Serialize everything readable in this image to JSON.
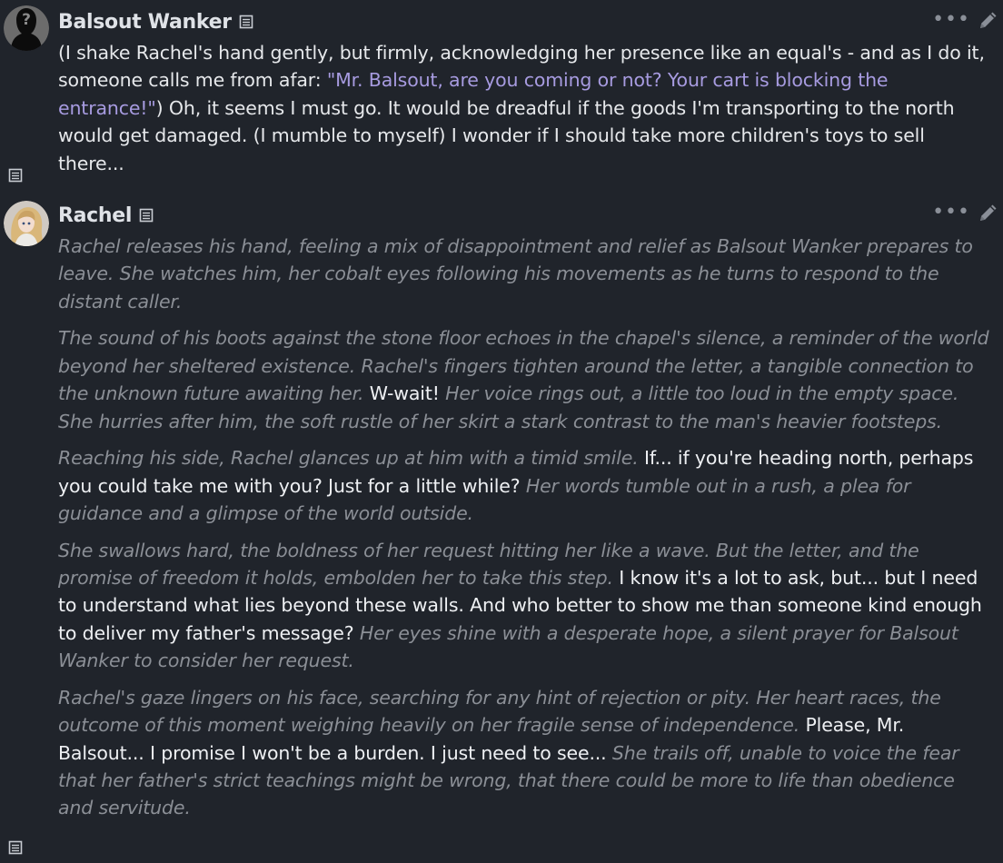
{
  "messages": [
    {
      "author": "Balsout Wanker",
      "avatar_icon": "question-mark-silhouette-avatar",
      "text_parts": [
        "(I shake Rachel's hand gently, but firmly, acknowledging her presence like an equal's - and as I do it, someone calls me from afar: ",
        "\"Mr. Balsout, are you coming or not? Your cart is blocking the entrance!\"",
        ") Oh, it seems I must go. It would be dreadful if the goods I'm transporting to the north would get damaged. (I mumble to myself) I wonder if I should take more children's toys to sell there..."
      ]
    },
    {
      "author": "Rachel",
      "avatar_icon": "blonde-girl-avatar",
      "paragraphs": [
        {
          "narration_1": "Rachel releases his hand, feeling a mix of disappointment and relief as Balsout Wanker prepares to leave. She watches him, her cobalt eyes following his movements as he turns to respond to the distant caller."
        },
        {
          "narration_1": "The sound of his boots against the stone floor echoes in the chapel's silence, a reminder of the world beyond her sheltered existence. Rachel's fingers tighten around the letter, a tangible connection to the unknown future awaiting her.",
          "speech": "W-wait!",
          "narration_2": "Her voice rings out, a little too loud in the empty space. She hurries after him, the soft rustle of her skirt a stark contrast to the man's heavier footsteps."
        },
        {
          "narration_1": "Reaching his side, Rachel glances up at him with a timid smile.",
          "speech": "If... if you're heading north, perhaps you could take me with you? Just for a little while?",
          "narration_2": "Her words tumble out in a rush, a plea for guidance and a glimpse of the world outside."
        },
        {
          "narration_1": "She swallows hard, the boldness of her request hitting her like a wave. But the letter, and the promise of freedom it holds, embolden her to take this step.",
          "speech": "I know it's a lot to ask, but... but I need to understand what lies beyond these walls. And who better to show me than someone kind enough to deliver my father's message?",
          "narration_2": "Her eyes shine with a desperate hope, a silent prayer for Balsout Wanker to consider her request."
        },
        {
          "narration_1": "Rachel's gaze lingers on his face, searching for any hint of rejection or pity. Her heart races, the outcome of this moment weighing heavily on her fragile sense of independence.",
          "speech": "Please, Mr. Balsout... I promise I won't be a burden. I just need to see...",
          "narration_2": "She trails off, unable to voice the fear that her father's strict teachings might be wrong, that there could be more to life than obedience and servitude."
        }
      ]
    }
  ],
  "colors": {
    "background": "#20242b",
    "name_text": "#dfe2e7",
    "quote_text": "#a79be0",
    "narration_text": "#8b8f96",
    "speech_text": "#eef0f3"
  },
  "icons": {
    "name_icon": "message-list-icon",
    "side_icon": "message-list-icon",
    "more_icon": "more-options-icon",
    "edit_icon": "pencil-edit-icon"
  }
}
